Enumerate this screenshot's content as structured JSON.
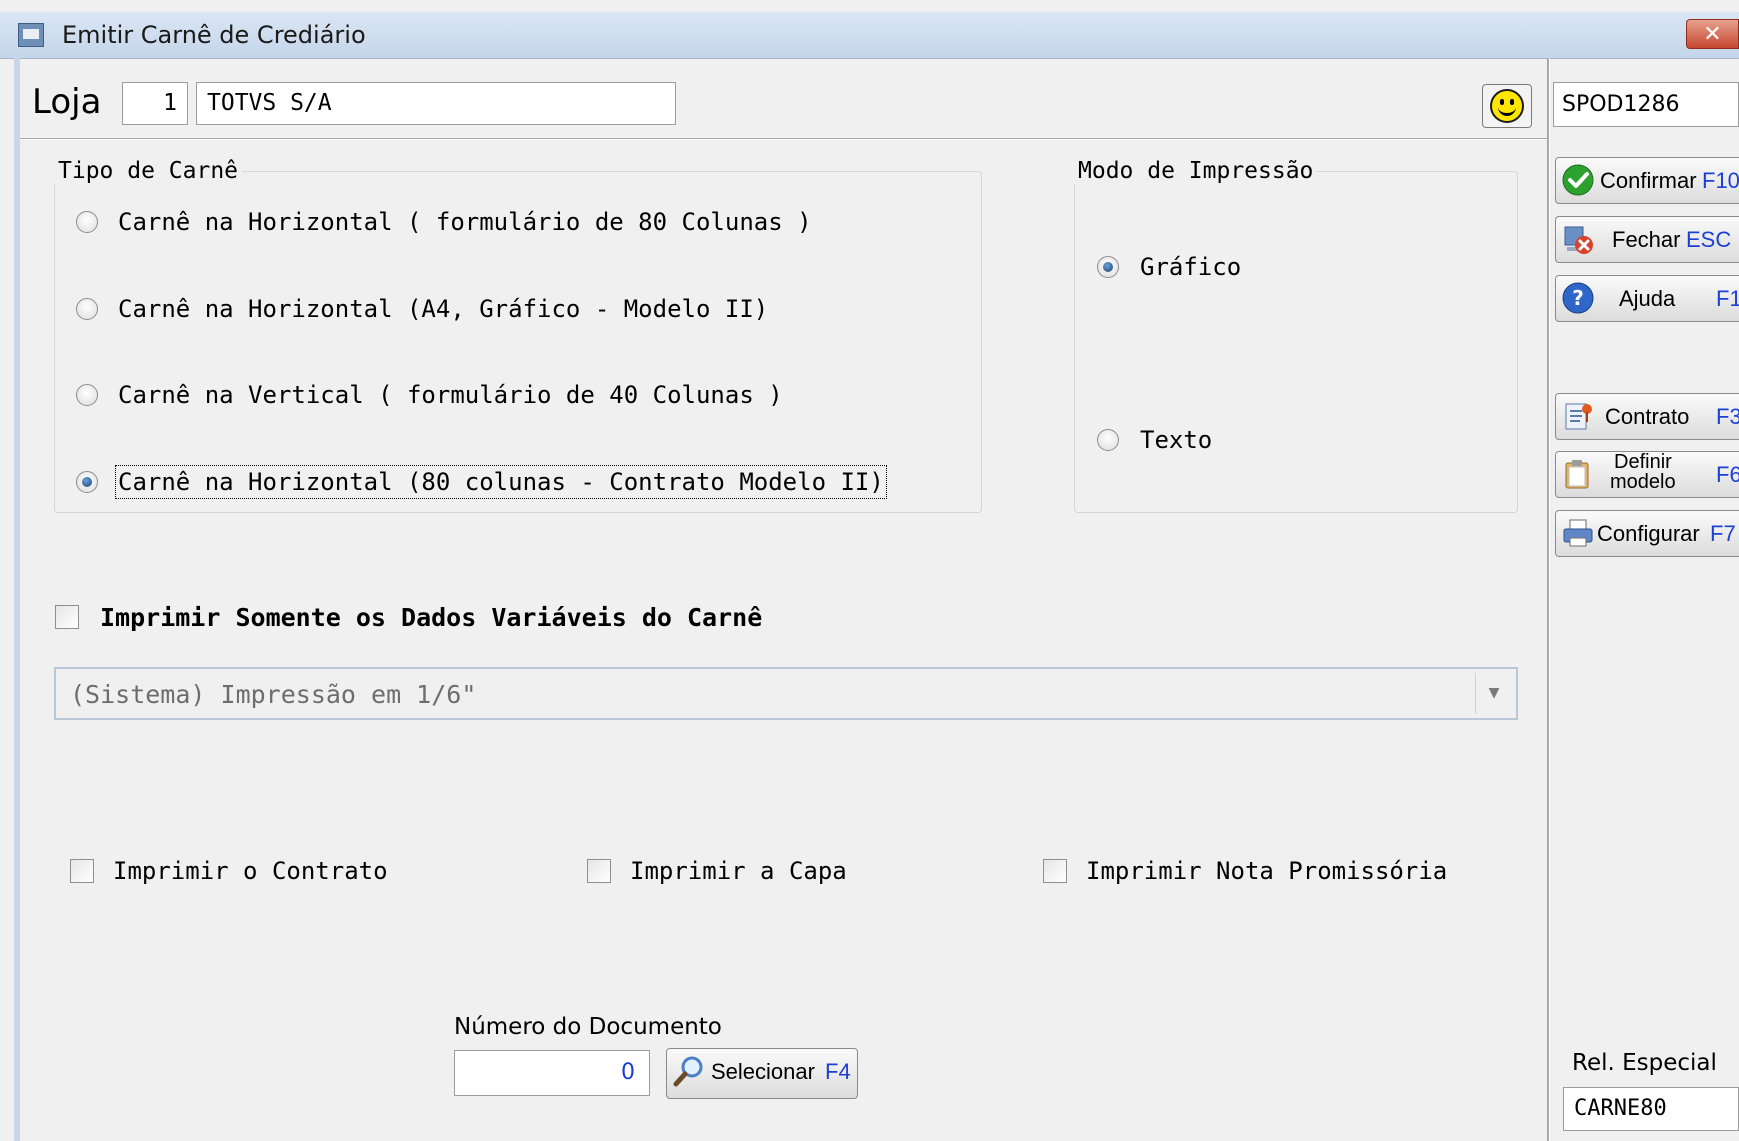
{
  "window": {
    "title": "Emitir Carnê de Crediário",
    "close_symbol": "✕"
  },
  "header": {
    "loja_label": "Loja",
    "loja_number": "1",
    "loja_name": "TOTVS S/A",
    "station": "SPOD1286"
  },
  "tipo_carne": {
    "title": "Tipo de Carnê",
    "options": [
      {
        "label": "Carnê na Horizontal ( formulário de 80 Colunas )",
        "selected": false
      },
      {
        "label": "Carnê na Horizontal (A4, Gráfico - Modelo II)",
        "selected": false
      },
      {
        "label": "Carnê na Vertical ( formulário de 40 Colunas )",
        "selected": false
      },
      {
        "label": "Carnê na Horizontal (80 colunas - Contrato Modelo II)",
        "selected": true
      }
    ]
  },
  "modo_impressao": {
    "title": "Modo de Impressão",
    "options": [
      {
        "label": "Gráfico",
        "selected": true
      },
      {
        "label": "Texto",
        "selected": false
      }
    ]
  },
  "options": {
    "dados_variaveis": "Imprimir Somente os Dados Variáveis do Carnê",
    "combo_value": "(Sistema) Impressão em 1/6\"",
    "contrato": "Imprimir o Contrato",
    "capa": "Imprimir a Capa",
    "nota_promissoria": "Imprimir Nota Promissória"
  },
  "documento": {
    "label": "Número do Documento",
    "value": "0",
    "select_label": "Selecionar",
    "select_key": "F4"
  },
  "sidebar": {
    "confirmar": {
      "label": "Confirmar",
      "key": "F10"
    },
    "fechar": {
      "label": "Fechar",
      "key": "ESC"
    },
    "ajuda": {
      "label": "Ajuda",
      "key": "F1"
    },
    "contrato": {
      "label": "Contrato",
      "key": "F3"
    },
    "definir_modelo": {
      "label_line1": "Definir",
      "label_line2": "modelo",
      "key": "F6"
    },
    "configurar": {
      "label": "Configurar",
      "key": "F7"
    },
    "rel_especial_label": "Rel. Especial",
    "rel_especial_value": "CARNE80"
  },
  "colors": {
    "accent_key": "#1c3fd6",
    "confirm_green": "#2da12d",
    "close_red": "#d9412b"
  }
}
